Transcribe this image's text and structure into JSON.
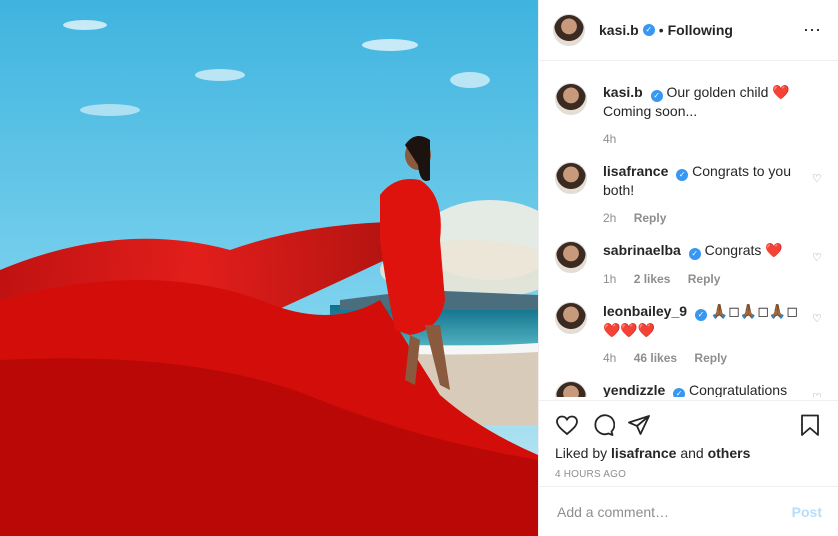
{
  "header": {
    "username": "kasi.b",
    "verified_mark": "✓",
    "separator": "•",
    "follow_status": "Following",
    "more_icon": "⋯"
  },
  "comments": [
    {
      "username": "kasi.b",
      "text": "Our golden child ❤️ Coming soon...",
      "time": "4h",
      "likes": "",
      "reply": ""
    },
    {
      "username": "lisafrance",
      "text": "Congrats to you both!",
      "time": "2h",
      "likes": "",
      "reply": "Reply"
    },
    {
      "username": "sabrinaelba",
      "text": "Congrats ❤️",
      "time": "1h",
      "likes": "2 likes",
      "reply": "Reply"
    },
    {
      "username": "leonbailey_9",
      "text": "🙏🏾◻🙏🏾◻🙏🏾◻❤️❤️❤️",
      "time": "4h",
      "likes": "46 likes",
      "reply": "Reply"
    },
    {
      "username": "yendizzle",
      "text": "Congratulations to",
      "time": "",
      "likes": "",
      "reply": ""
    }
  ],
  "actions": {
    "liked_prefix": "Liked by",
    "liked_user": "lisafrance",
    "liked_and": "and",
    "liked_others": "others",
    "time_ago": "4 HOURS AGO"
  },
  "add_comment": {
    "placeholder": "Add a comment…",
    "post_label": "Post"
  },
  "colors": {
    "accent": "#3897f0",
    "dress": "#e0100a",
    "post_disabled": "#b2dffc"
  }
}
